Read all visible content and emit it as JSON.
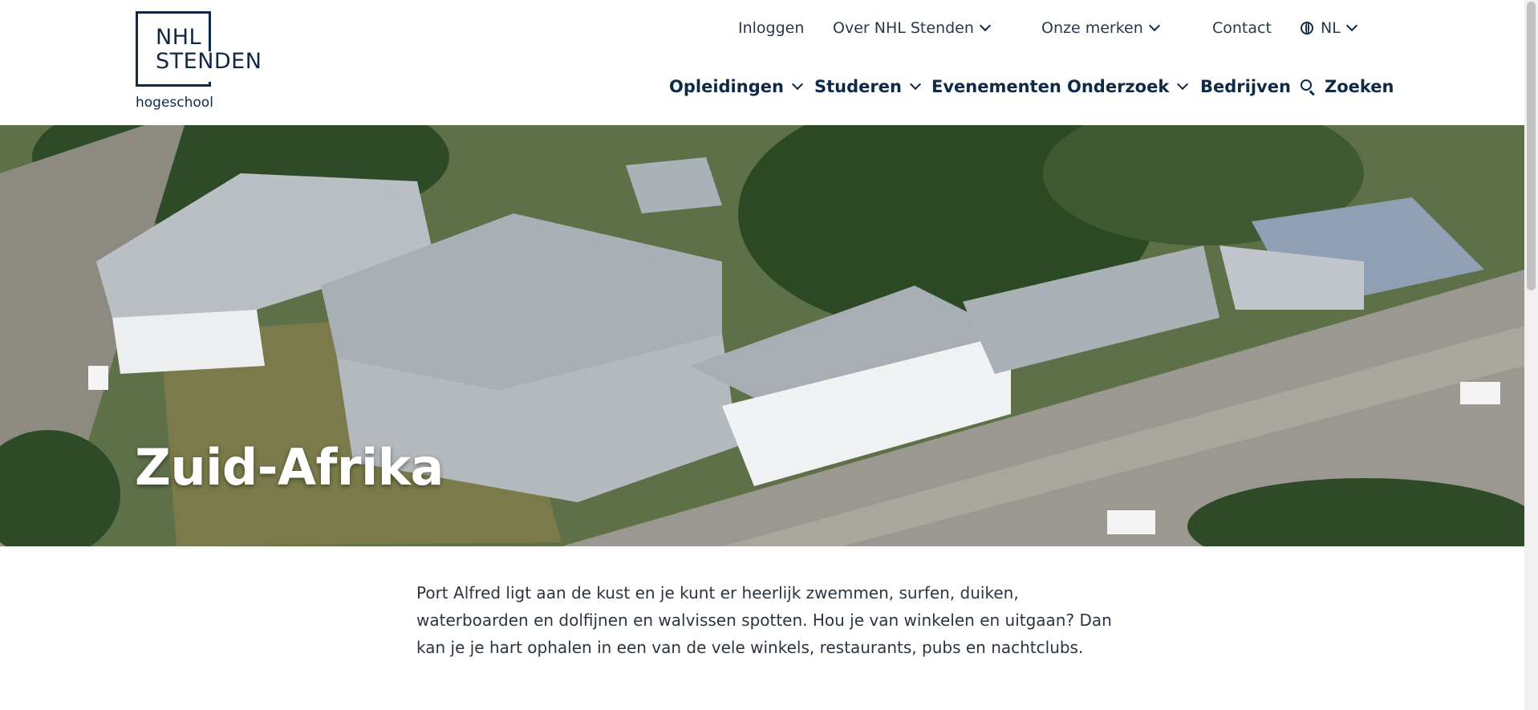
{
  "logo": {
    "line1": "NHL",
    "line2": "STENDEN",
    "sub": "hogeschool"
  },
  "topnav": {
    "login": "Inloggen",
    "about": "Over NHL Stenden",
    "brands": "Onze merken",
    "contact": "Contact",
    "lang": "NL"
  },
  "mainnav": {
    "programs": "Opleidingen",
    "study": "Studeren",
    "events": "Evenementen",
    "research": "Onderzoek",
    "companies": "Bedrijven",
    "search": "Zoeken"
  },
  "hero": {
    "title": "Zuid-Afrika"
  },
  "intro": {
    "text": "Port Alfred ligt aan de kust en je kunt er heerlijk zwemmen, surfen, duiken, waterboarden en dolfijnen en walvissen spotten. Hou je van winkelen en uitgaan? Dan kan je je hart ophalen in een van de vele winkels, restaurants, pubs en nachtclubs."
  },
  "colors": {
    "brand": "#0e2a47",
    "text": "#2c3440"
  }
}
